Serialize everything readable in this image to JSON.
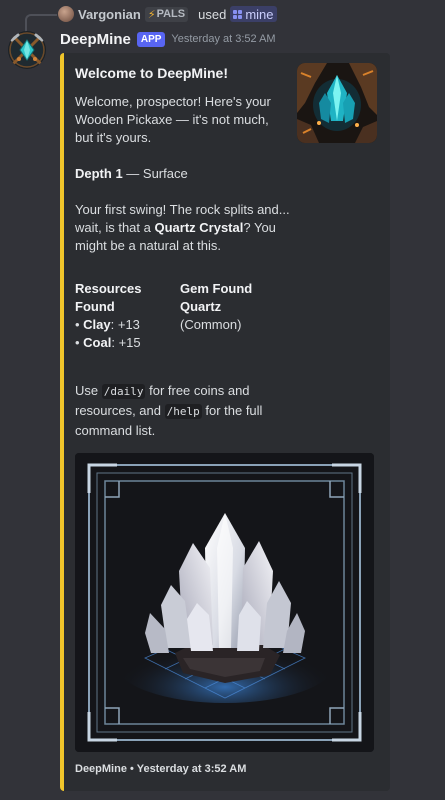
{
  "reply": {
    "user": "Vargonian",
    "tag": "PALS",
    "used_text": "used",
    "command": "mine"
  },
  "message": {
    "bot_name": "DeepMine",
    "badge": "APP",
    "timestamp": "Yesterday at 3:52 AM"
  },
  "embed": {
    "accent_color": "#f0c52b",
    "title": "Welcome to DeepMine!",
    "intro": "Welcome, prospector! Here's your Wooden Pickaxe — it's not much, but it's yours.",
    "depth_label": "Depth 1",
    "depth_value": " — Surface",
    "swing_text_1": "Your first swing! The rock splits and... wait, is that a ",
    "swing_gem": "Quartz Crystal",
    "swing_text_2": "? You might be a natural at this.",
    "fields": {
      "resources": {
        "name": "Resources Found",
        "items": [
          {
            "label": "Clay",
            "value": ": +13"
          },
          {
            "label": "Coal",
            "value": ": +15"
          }
        ]
      },
      "gem": {
        "name": "Gem Found",
        "gem_name": "Quartz",
        "rarity": "(Common)"
      }
    },
    "help_1": "Use ",
    "help_cmd_1": "/daily",
    "help_2": " for free coins and resources, and ",
    "help_cmd_2": "/help",
    "help_3": " for the full command list.",
    "footer": "DeepMine • Yesterday at 3:52 AM"
  },
  "icons": {
    "bot_avatar": "crystal-emblem-icon",
    "thumbnail": "mine-crystal-icon",
    "command": "slash-command-icon",
    "tag": "lightning-icon"
  }
}
